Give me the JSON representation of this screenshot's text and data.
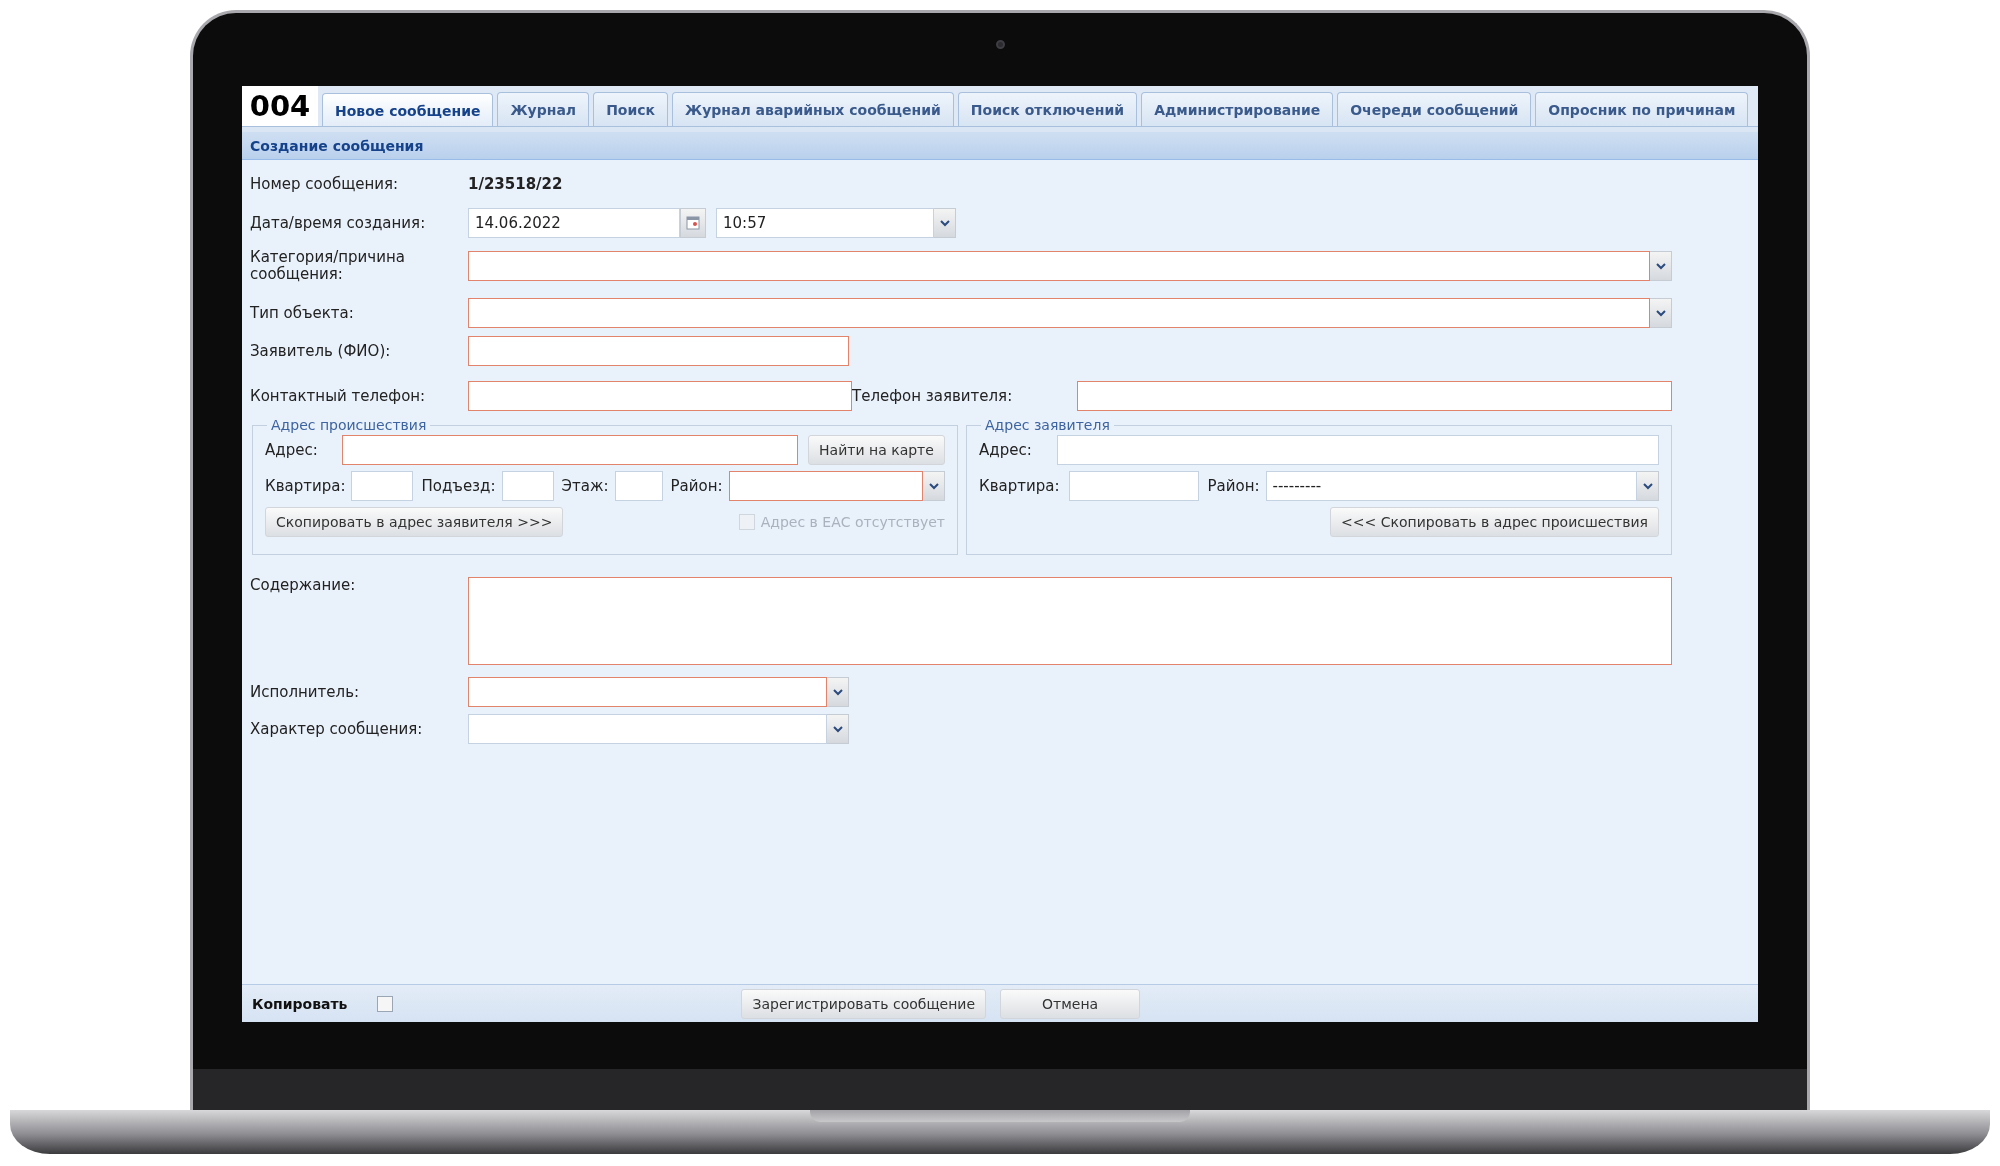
{
  "logo": "004",
  "tabs": [
    {
      "label": "Новое сообщение",
      "selected": true
    },
    {
      "label": "Журнал",
      "selected": false
    },
    {
      "label": "Поиск",
      "selected": false
    },
    {
      "label": "Журнал аварийных сообщений",
      "selected": false
    },
    {
      "label": "Поиск отключений",
      "selected": false
    },
    {
      "label": "Администрирование",
      "selected": false
    },
    {
      "label": "Очереди сообщений",
      "selected": false
    },
    {
      "label": "Опросник по причинам",
      "selected": false
    }
  ],
  "section_title": "Создание сообщения",
  "message_number": {
    "label": "Номер сообщения:",
    "value": "1/23518/22"
  },
  "created": {
    "label": "Дата/время создания:",
    "date": "14.06.2022",
    "time": "10:57"
  },
  "category": {
    "label": "Категория/причина сообщения:",
    "required": true
  },
  "object_type": {
    "label": "Тип объекта:",
    "required": true
  },
  "applicant": {
    "label": "Заявитель (ФИО):",
    "required": true
  },
  "contact_phone": {
    "label": "Контактный телефон:",
    "required": true
  },
  "applicant_phone": {
    "label": "Телефон заявителя:",
    "required": true
  },
  "incident_address": {
    "legend": "Адрес происшествия",
    "address": {
      "label": "Адрес:",
      "required": true
    },
    "find_button": "Найти на карте",
    "apartment": {
      "label": "Квартира:",
      "required": false
    },
    "entrance": {
      "label": "Подъезд:",
      "required": false
    },
    "floor": {
      "label": "Этаж:",
      "required": false
    },
    "district": {
      "label": "Район:",
      "required": true
    },
    "copy_button": "Скопировать в адрес заявителя >>>",
    "eas_missing": {
      "label": "Адрес в ЕАС отсутствует",
      "checked": false,
      "disabled": true
    }
  },
  "applicant_address": {
    "legend": "Адрес заявителя",
    "address": {
      "label": "Адрес:",
      "required": false
    },
    "apartment": {
      "label": "Квартира:",
      "required": false
    },
    "district": {
      "label": "Район:",
      "value": "---------",
      "required": false
    },
    "copy_button": "<<< Скопировать в адрес происшествия"
  },
  "content": {
    "label": "Содержание:",
    "required": true
  },
  "executor": {
    "label": "Исполнитель:",
    "required": true
  },
  "character": {
    "label": "Характер сообщения:",
    "required": false
  },
  "footer": {
    "copy": {
      "label": "Копировать",
      "checked": false
    },
    "buttons": [
      "Зарегистрировать сообщение",
      "Отмена"
    ]
  }
}
